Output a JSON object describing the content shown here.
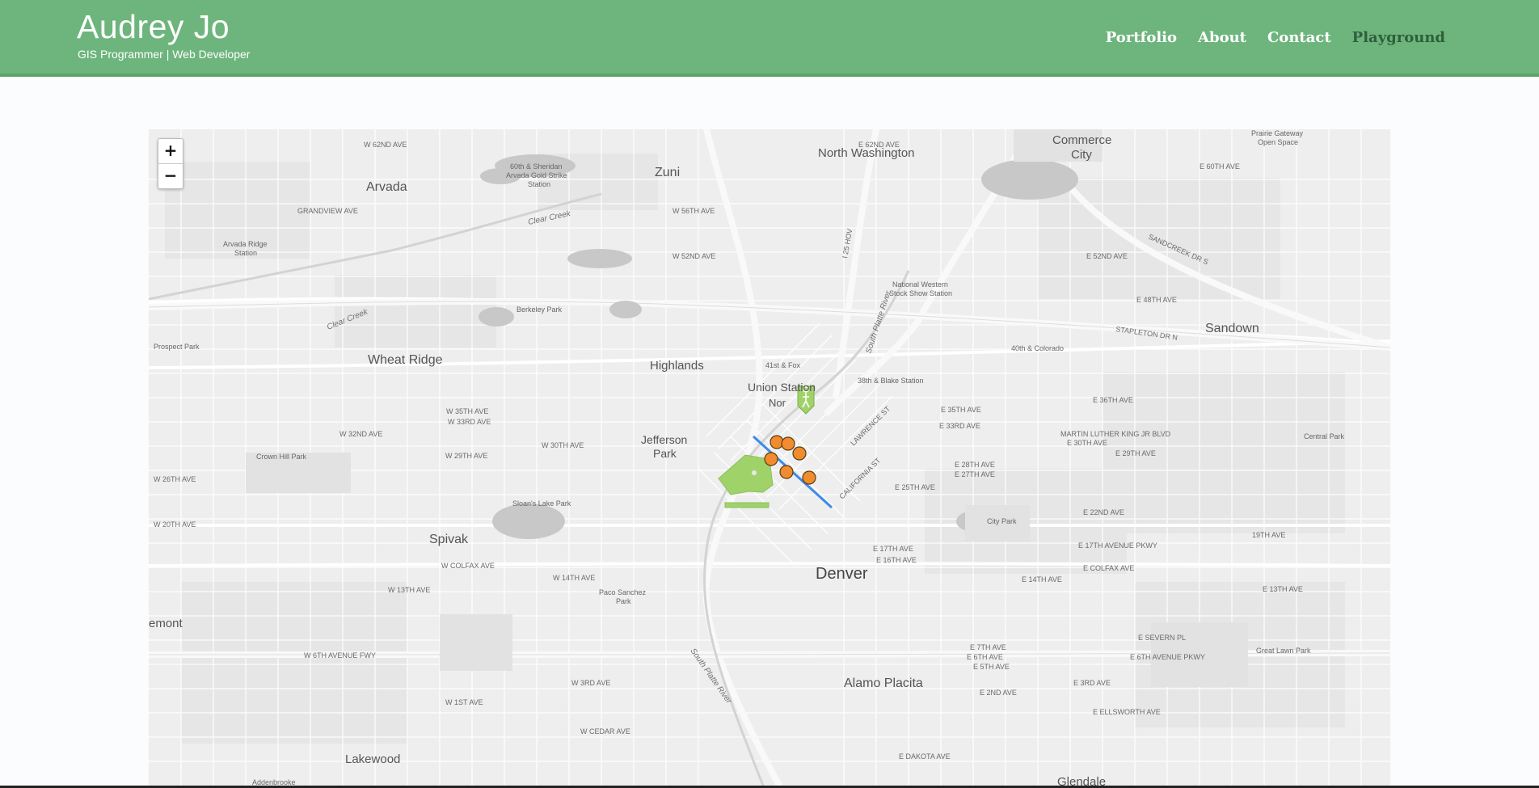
{
  "site": {
    "title": "Audrey Jo",
    "subtitle": "GIS Programmer | Web Developer"
  },
  "nav": {
    "items": [
      {
        "label": "Portfolio",
        "active": false
      },
      {
        "label": "About",
        "active": false
      },
      {
        "label": "Contact",
        "active": false
      },
      {
        "label": "Playground",
        "active": true
      }
    ]
  },
  "map": {
    "zoom_in": "+",
    "zoom_out": "−",
    "place_labels": [
      {
        "text": "North Washington",
        "kind": "city"
      },
      {
        "text": "Commerce City",
        "kind": "city"
      },
      {
        "text": "Arvada",
        "kind": "city"
      },
      {
        "text": "Zuni",
        "kind": "city"
      },
      {
        "text": "Wheat Ridge",
        "kind": "city"
      },
      {
        "text": "Highlands",
        "kind": "city"
      },
      {
        "text": "Sandown",
        "kind": "city"
      },
      {
        "text": "Union Station",
        "kind": "city"
      },
      {
        "text": "Jefferson Park",
        "kind": "city"
      },
      {
        "text": "Spivak",
        "kind": "city"
      },
      {
        "text": "Denver",
        "kind": "major"
      },
      {
        "text": "Alamo Placita",
        "kind": "city"
      },
      {
        "text": "Lakewood",
        "kind": "city"
      },
      {
        "text": "emont",
        "kind": "city"
      },
      {
        "text": "Glendale",
        "kind": "city"
      },
      {
        "text": "Prairie Gateway Open Space",
        "kind": "poi"
      },
      {
        "text": "60th & Sheridan Arvada Gold Strike Station",
        "kind": "poi"
      },
      {
        "text": "Arvada Ridge Station",
        "kind": "poi"
      },
      {
        "text": "Berkeley Park",
        "kind": "poi"
      },
      {
        "text": "Prospect Park",
        "kind": "poi"
      },
      {
        "text": "National Western Stock Show Station",
        "kind": "poi"
      },
      {
        "text": "41st & Fox",
        "kind": "poi"
      },
      {
        "text": "38th & Blake Station",
        "kind": "poi"
      },
      {
        "text": "40th & Colorado",
        "kind": "poi"
      },
      {
        "text": "Crown Hill Park",
        "kind": "poi"
      },
      {
        "text": "Sloan's Lake Park",
        "kind": "poi"
      },
      {
        "text": "City Park",
        "kind": "poi"
      },
      {
        "text": "Central Park",
        "kind": "poi"
      },
      {
        "text": "Paco Sanchez Park",
        "kind": "poi"
      },
      {
        "text": "Great Lawn Park",
        "kind": "poi"
      },
      {
        "text": "Addenbrooke",
        "kind": "poi"
      },
      {
        "text": "Clear Creek",
        "kind": "water"
      },
      {
        "text": "South Platte River",
        "kind": "water"
      }
    ],
    "street_labels": [
      "W 62ND AVE",
      "E 62ND AVE",
      "E 60TH AVE",
      "GRANDVIEW AVE",
      "W 56TH AVE",
      "W 52ND AVE",
      "E 52ND AVE",
      "E 48TH AVE",
      "STAPLETON DR N",
      "SANDCREEK DR S",
      "W 35TH AVE",
      "W 33RD AVE",
      "W 32ND AVE",
      "W 30TH AVE",
      "W 29TH AVE",
      "W 26TH AVE",
      "W 20TH AVE",
      "W COLFAX AVE",
      "W 14TH AVE",
      "W 13TH AVE",
      "W 6TH AVENUE FWY",
      "W 3RD AVE",
      "W 1ST AVE",
      "W CEDAR AVE",
      "E 35TH AVE",
      "E 33RD AVE",
      "E 28TH AVE",
      "E 27TH AVE",
      "E 25TH AVE",
      "E 36TH AVE",
      "E 30TH AVE",
      "E 29TH AVE",
      "E 22ND AVE",
      "E 17TH AVE",
      "E 16TH AVE",
      "E 17TH AVENUE PKWY",
      "E COLFAX AVE",
      "E 14TH AVE",
      "E 13TH AVE",
      "E 7TH AVE",
      "E 6TH AVE",
      "E 5TH AVE",
      "E 6TH AVENUE PKWY",
      "E 3RD AVE",
      "E 2ND AVE",
      "E ELLSWORTH AVE",
      "E DAKOTA AVE",
      "MARTIN LUTHER KING JR BLVD",
      "LAWRENCE ST",
      "CALIFORNIA ST",
      "E SEVERN PL",
      "19TH AVE",
      "I 25 HOV"
    ]
  },
  "colors": {
    "header": "#6db57d",
    "active_nav": "#2f5f3a",
    "map_bg": "#eeeeee",
    "park_fill": "#9fd36a",
    "marker_fill": "#f08c2e",
    "line": "#3b8beb"
  }
}
